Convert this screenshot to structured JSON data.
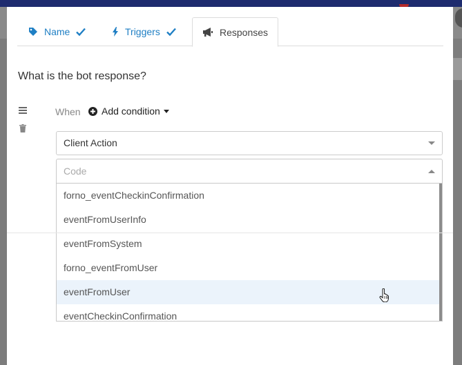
{
  "tabs": [
    {
      "label": "Name",
      "icon": "tag-icon",
      "completed": true
    },
    {
      "label": "Triggers",
      "icon": "bolt-icon",
      "completed": true
    },
    {
      "label": "Responses",
      "icon": "megaphone-icon",
      "active": true
    }
  ],
  "question": "What is the bot response?",
  "condition": {
    "when_label": "When",
    "add_label": "Add condition"
  },
  "response_type": {
    "selected": "Client Action"
  },
  "code_select": {
    "placeholder": "Code",
    "options": [
      "forno_eventCheckinConfirmation",
      "eventFromUserInfo",
      "eventFromSystem",
      "forno_eventFromUser",
      "eventFromUser",
      "eventCheckinConfirmation"
    ],
    "hovered_index": 4
  },
  "colors": {
    "link": "#1f7fc4",
    "hover_row": "#ebf3fb",
    "header_bar": "#1e2b6e"
  }
}
